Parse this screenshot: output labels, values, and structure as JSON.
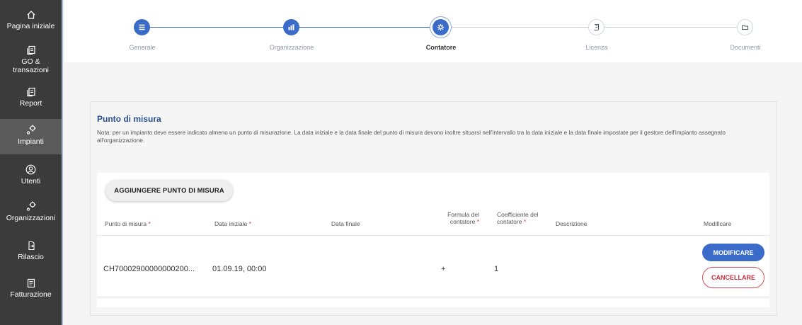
{
  "sidebar": {
    "items": [
      {
        "label": "Pagina iniziale",
        "icon": "home-icon"
      },
      {
        "label": "GO & transazioni",
        "icon": "documents-icon"
      },
      {
        "label": "Report",
        "icon": "documents-icon"
      },
      {
        "label": "Impianti",
        "icon": "plant-icon",
        "active": true
      },
      {
        "label": "Utenti",
        "icon": "user-icon"
      },
      {
        "label": "Organizzazioni",
        "icon": "plant-icon"
      },
      {
        "label": "Rilascio",
        "icon": "export-icon"
      },
      {
        "label": "Fatturazione",
        "icon": "invoice-icon"
      }
    ]
  },
  "stepper": {
    "steps": [
      {
        "label": "Generale",
        "state": "done",
        "icon": "list-icon"
      },
      {
        "label": "Organizzazione",
        "state": "done",
        "icon": "organization-icon"
      },
      {
        "label": "Contatore",
        "state": "current",
        "icon": "gear-icon"
      },
      {
        "label": "Licenza",
        "state": "todo",
        "icon": "license-icon"
      },
      {
        "label": "Documenti",
        "state": "todo",
        "icon": "folder-icon"
      }
    ]
  },
  "section": {
    "title": "Punto di misura",
    "note": "Nota: per un impianto deve essere indicato almeno un punto di misurazione. La data iniziale e la data finale del punto di misura devono inoltre situarsi nell'intervallo tra la data iniziale e la data finale impostate per il gestore dell'impianto assegnato all'organizzazione."
  },
  "table": {
    "add_button": "AGGIUNGERE PUNTO DI MISURA",
    "headers": {
      "measure_point": "Punto di misura",
      "start_date": "Data iniziale",
      "end_date": "Data finale",
      "formula_l1": "Formula del",
      "formula_l2": "contatore",
      "coeff_l1": "Coefficiente del",
      "coeff_l2": "contatore",
      "description": "Descrizione",
      "edit": "Modificare",
      "required_mark": "*"
    },
    "rows": [
      {
        "measure_point": "CH70002900000000200...",
        "start_date": "01.09.19, 00:00",
        "end_date": "",
        "formula": "+",
        "coefficient": "1",
        "description": "",
        "edit_label": "MODIFICARE",
        "delete_label": "CANCELLARE"
      }
    ]
  },
  "colors": {
    "accent": "#3a6bc8",
    "sidebar_bg": "#3b3b3b",
    "danger": "#c8303f",
    "title": "#2c4f8f"
  }
}
